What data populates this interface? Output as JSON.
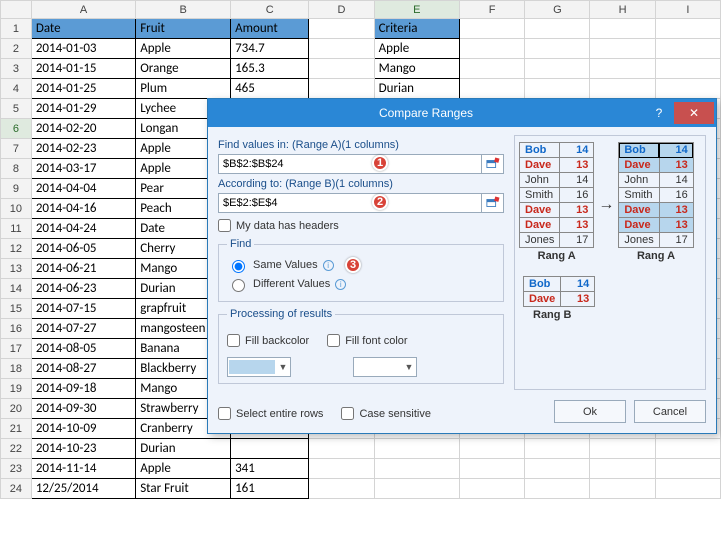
{
  "columns": [
    "A",
    "B",
    "C",
    "D",
    "E",
    "F",
    "G",
    "H",
    "I"
  ],
  "sel_col": "E",
  "sel_row": 6,
  "headers": {
    "date": "Date",
    "fruit": "Fruit",
    "amount": "Amount",
    "criteria": "Criteria"
  },
  "rows": [
    {
      "n": 1
    },
    {
      "n": 2,
      "date": "2014-01-03",
      "fruit": "Apple",
      "amount": "734.7",
      "crit": "Apple"
    },
    {
      "n": 3,
      "date": "2014-01-15",
      "fruit": "Orange",
      "amount": "165.3",
      "crit": "Mango"
    },
    {
      "n": 4,
      "date": "2014-01-25",
      "fruit": "Plum",
      "amount": "465",
      "crit": "Durian"
    },
    {
      "n": 5,
      "date": "2014-01-29",
      "fruit": "Lychee"
    },
    {
      "n": 6,
      "date": "2014-02-20",
      "fruit": "Longan"
    },
    {
      "n": 7,
      "date": "2014-02-23",
      "fruit": "Apple"
    },
    {
      "n": 8,
      "date": "2014-03-17",
      "fruit": "Apple"
    },
    {
      "n": 9,
      "date": "2014-04-04",
      "fruit": "Pear"
    },
    {
      "n": 10,
      "date": "2014-04-16",
      "fruit": "Peach"
    },
    {
      "n": 11,
      "date": "2014-04-24",
      "fruit": "Date"
    },
    {
      "n": 12,
      "date": "2014-06-05",
      "fruit": "Cherry"
    },
    {
      "n": 13,
      "date": "2014-06-21",
      "fruit": "Mango"
    },
    {
      "n": 14,
      "date": "2014-06-23",
      "fruit": "Durian"
    },
    {
      "n": 15,
      "date": "2014-07-15",
      "fruit": "grapfruit"
    },
    {
      "n": 16,
      "date": "2014-07-27",
      "fruit": "mangosteen"
    },
    {
      "n": 17,
      "date": "2014-08-05",
      "fruit": "Banana"
    },
    {
      "n": 18,
      "date": "2014-08-27",
      "fruit": "Blackberry"
    },
    {
      "n": 19,
      "date": "2014-09-18",
      "fruit": "Mango"
    },
    {
      "n": 20,
      "date": "2014-09-30",
      "fruit": "Strawberry"
    },
    {
      "n": 21,
      "date": "2014-10-09",
      "fruit": "Cranberry"
    },
    {
      "n": 22,
      "date": "2014-10-23",
      "fruit": "Durian"
    },
    {
      "n": 23,
      "date": "2014-11-14",
      "fruit": "Apple",
      "amount": "341"
    },
    {
      "n": 24,
      "date": "12/25/2014",
      "fruit": "Star Fruit",
      "amount": "161"
    }
  ],
  "dialog": {
    "title": "Compare Ranges",
    "help": "?",
    "close": "✕",
    "findLbl": "Find values in: (Range A)(1 columns)",
    "rangeA": "$B$2:$B$24",
    "accLbl": "According to: (Range B)(1 columns)",
    "rangeB": "$E$2:$E$4",
    "hasHeaders": "My data has headers",
    "findGroup": "Find",
    "sameValues": "Same Values",
    "diffValues": "Different Values",
    "procGroup": "Processing of results",
    "fillBack": "Fill backcolor",
    "fillFont": "Fill font color",
    "selectEntire": "Select entire rows",
    "caseSensitive": "Case sensitive",
    "ok": "Ok",
    "cancel": "Cancel",
    "badge1": "1",
    "badge2": "2",
    "badge3": "3",
    "prevA": "Rang A",
    "prevB": "Rang B",
    "pRows": [
      {
        "name": "Bob",
        "val": "14",
        "cls": "bold-blue"
      },
      {
        "name": "Dave",
        "val": "13",
        "cls": "bold-red"
      },
      {
        "name": "John",
        "val": "14",
        "cls": ""
      },
      {
        "name": "Smith",
        "val": "16",
        "cls": ""
      },
      {
        "name": "Dave",
        "val": "13",
        "cls": "bold-red"
      },
      {
        "name": "Dave",
        "val": "13",
        "cls": "bold-red"
      },
      {
        "name": "Jones",
        "val": "17",
        "cls": ""
      }
    ],
    "pBRows": [
      {
        "name": "Bob",
        "val": "14",
        "cls": "bold-blue"
      },
      {
        "name": "Dave",
        "val": "13",
        "cls": "bold-red"
      }
    ]
  }
}
